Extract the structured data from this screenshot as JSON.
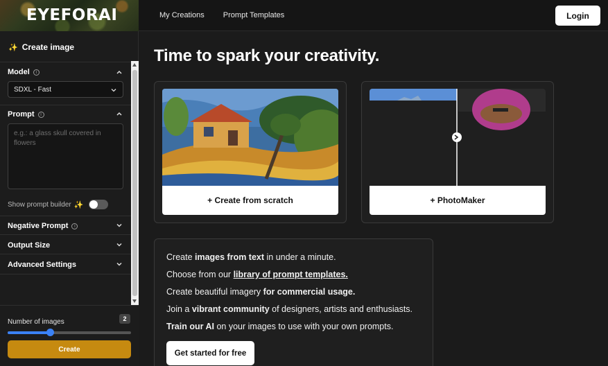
{
  "header": {
    "logo": "EYEFORAI",
    "nav": [
      "My Creations",
      "Prompt Templates"
    ],
    "login_label": "Login"
  },
  "sidebar": {
    "title": "Create image",
    "model": {
      "label": "Model",
      "value": "SDXL - Fast"
    },
    "prompt": {
      "label": "Prompt",
      "placeholder": "e.g.: a glass skull covered in flowers"
    },
    "prompt_builder_label": "Show prompt builder",
    "prompt_builder_on": false,
    "negative_prompt_label": "Negative Prompt",
    "output_size_label": "Output Size",
    "advanced_label": "Advanced Settings",
    "num_images_label": "Number of images",
    "num_images_value": "2",
    "num_images_fraction": 0.34,
    "create_label": "Create"
  },
  "main": {
    "headline": "Time to spark your creativity.",
    "cards": [
      {
        "label": "+ Create from scratch"
      },
      {
        "label": "+ PhotoMaker"
      }
    ],
    "info": {
      "lines": [
        {
          "pre": "Create ",
          "strong": "images from text",
          "post": " in under a minute."
        },
        {
          "pre": "Choose from our ",
          "link": "library of prompt templates.",
          "post": ""
        },
        {
          "pre": "Create beautiful imagery ",
          "strong": "for commercial usage.",
          "post": ""
        },
        {
          "pre": "Join a ",
          "strong": "vibrant community",
          "post": " of designers, artists and enthusiasts."
        },
        {
          "pre": "",
          "strong": "Train our AI",
          "post": " on your images to use with your own prompts."
        }
      ],
      "cta_label": "Get started for free"
    }
  },
  "colors": {
    "accent": "#c68a10",
    "slider": "#3b82f6",
    "background": "#1b1b1b"
  }
}
